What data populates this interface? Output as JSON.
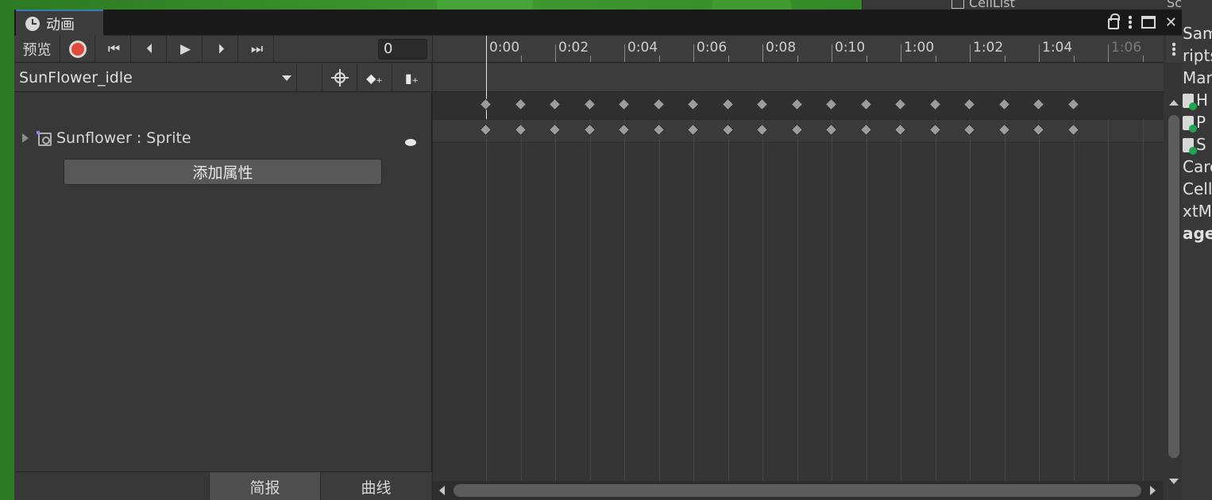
{
  "window": {
    "tab_title": "动画",
    "tab_icon": "clock-icon"
  },
  "background": {
    "hierarchy_item": "CellList",
    "scenes_label": "Scenes",
    "project_items": [
      "Sam",
      "ripts",
      "Mar",
      "H",
      "P",
      "S",
      "Carc",
      "Cell",
      "xtM",
      "age"
    ]
  },
  "toolbar": {
    "preview_label": "预览",
    "frame_value": "0"
  },
  "clip": {
    "name": "SunFlower_idle"
  },
  "property": {
    "label": "Sunflower : Sprite"
  },
  "add_property_label": "添加属性",
  "bottom_tabs": {
    "dopesheet": "简报",
    "curves": "曲线"
  },
  "timeline": {
    "ticks": [
      "0:00",
      "0:02",
      "0:04",
      "0:06",
      "0:08",
      "0:10",
      "1:00",
      "1:02",
      "1:04",
      "1:06"
    ],
    "keyframe_count": 18
  },
  "colors": {
    "accent": "#3a79bb",
    "record": "#e04a3a"
  }
}
